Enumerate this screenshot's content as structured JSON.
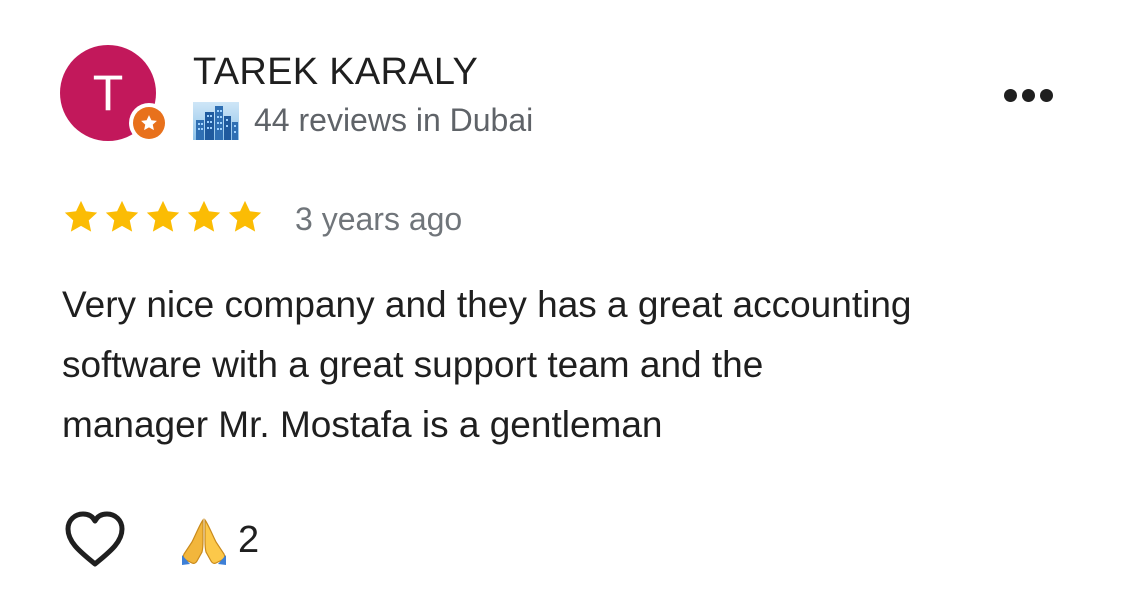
{
  "reviewer": {
    "avatar_initial": "T",
    "avatar_color": "#c2185b",
    "name": "TAREK KARALY",
    "meta": "44 reviews in Dubai",
    "badge_icon": "local-guide-star-icon",
    "city_icon": "city-skyline-icon"
  },
  "review": {
    "rating": 5,
    "rating_max": 5,
    "star_color": "#fbbc04",
    "time": "3 years ago",
    "text_lines": [
      "Very nice company and they has a great accounting",
      "software with a great support team and the",
      "manager Mr. Mostafa is a gentleman"
    ]
  },
  "actions": {
    "more_icon": "more-horizontal-icon",
    "like_icon": "heart-outline-icon",
    "reaction_icon": "folded-hands-emoji",
    "reaction_count": "2"
  }
}
